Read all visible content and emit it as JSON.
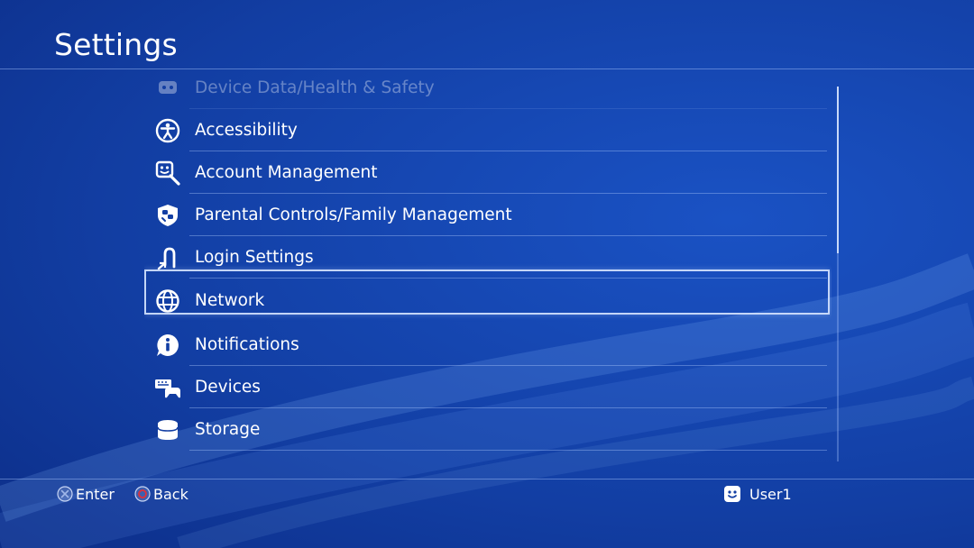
{
  "header": {
    "title": "Settings"
  },
  "settings_list": {
    "items": [
      {
        "label": "Device Data/Health & Safety",
        "icon": "device-data-icon",
        "faded": true
      },
      {
        "label": "Accessibility",
        "icon": "accessibility-icon"
      },
      {
        "label": "Account Management",
        "icon": "account-management-icon"
      },
      {
        "label": "Parental Controls/Family Management",
        "icon": "parental-controls-icon"
      },
      {
        "label": "Login Settings",
        "icon": "login-settings-icon"
      },
      {
        "label": "Network",
        "icon": "network-globe-icon",
        "selected": true
      },
      {
        "label": "Notifications",
        "icon": "notifications-icon"
      },
      {
        "label": "Devices",
        "icon": "devices-icon"
      },
      {
        "label": "Storage",
        "icon": "storage-icon"
      }
    ]
  },
  "footer": {
    "enter_label": "Enter",
    "back_label": "Back",
    "enter_icon": "cross-button-icon",
    "back_icon": "circle-button-icon",
    "user_name": "User1",
    "user_icon": "user-avatar-icon"
  },
  "colors": {
    "background": "#123ea3",
    "text": "#ffffff",
    "focus_border": "#d7e6ff",
    "circle_button": "#e0303a"
  }
}
